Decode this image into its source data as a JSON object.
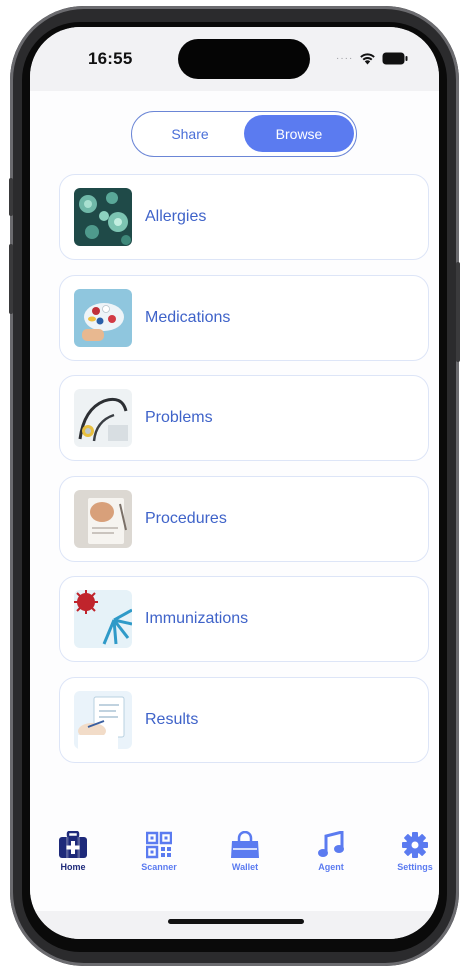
{
  "status_bar": {
    "time": "16:55"
  },
  "segmented_control": {
    "options": [
      "Share",
      "Browse"
    ],
    "selected": "Browse"
  },
  "categories": [
    {
      "label": "Allergies",
      "thumbnail": "allergen-spores-image"
    },
    {
      "label": "Medications",
      "thumbnail": "pills-image"
    },
    {
      "label": "Problems",
      "thumbnail": "stethoscope-image"
    },
    {
      "label": "Procedures",
      "thumbnail": "clipboard-procedure-image"
    },
    {
      "label": "Immunizations",
      "thumbnail": "virus-vaccine-image"
    },
    {
      "label": "Results",
      "thumbnail": "doctor-report-image"
    }
  ],
  "tab_bar": {
    "active": "Home",
    "items": [
      {
        "label": "Home",
        "icon": "medical-bag-icon"
      },
      {
        "label": "Scanner",
        "icon": "qr-code-icon"
      },
      {
        "label": "Wallet",
        "icon": "wallet-bag-icon"
      },
      {
        "label": "Agent",
        "icon": "music-note-icon"
      },
      {
        "label": "Settings",
        "icon": "gear-icon"
      }
    ]
  },
  "colors": {
    "accent": "#5b7bf0",
    "label": "#3f63c9",
    "active_tab": "#1e2a7a"
  }
}
